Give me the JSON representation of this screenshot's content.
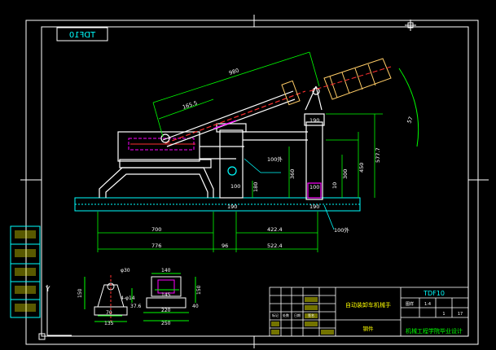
{
  "drawing": {
    "title_box_mirrored": "TDF10",
    "colors": {
      "background": "#000000",
      "frame": "#ffffff",
      "dim_cyan": "#00ffff",
      "dim_green": "#00ff00",
      "magenta": "#ff00ff",
      "red": "#ff3030",
      "yellow": "#ffff00",
      "orange_handle": "#ff8000",
      "blue": "#4060ff",
      "tan": "#ffcc66"
    }
  },
  "dimensions": {
    "boom_length": "980",
    "boom_inner": "165.5",
    "angle": "57",
    "h_577": "577.7",
    "h_450": "450",
    "h_300": "300",
    "h_360": "360",
    "h_180": "180",
    "h_10": "10",
    "d_190": "190",
    "d_100": "100",
    "d_180l": "180",
    "d_1008": "100外",
    "d_190b": "190",
    "d_190c": "190",
    "base_700": "700",
    "base_776": "776",
    "gap_96": "96",
    "span_4224": "422.4",
    "span_5224": "522.4",
    "note_1008": "100外",
    "det_phi30": "φ30",
    "det_140": "140",
    "det_145": "145",
    "det_4phi14": "4-φ14",
    "det_376": "37.6",
    "det_150": "150",
    "det_150r": "150",
    "det_70": "70",
    "det_135": "135",
    "det_220": "220",
    "det_250": "250",
    "det_40": "40",
    "y_axis": "Y"
  },
  "title_block": {
    "drawing_name": "自动装卸车机械手",
    "drawing_code": "TDF10",
    "school": "机械工程学院毕业设计",
    "material": "钢件",
    "label_a": "图样",
    "label_b": "1:4",
    "label_c": "1",
    "label_d": "17",
    "small_1": "标记",
    "small_2": "处数",
    "small_3": "日期",
    "small_4": "签名"
  }
}
